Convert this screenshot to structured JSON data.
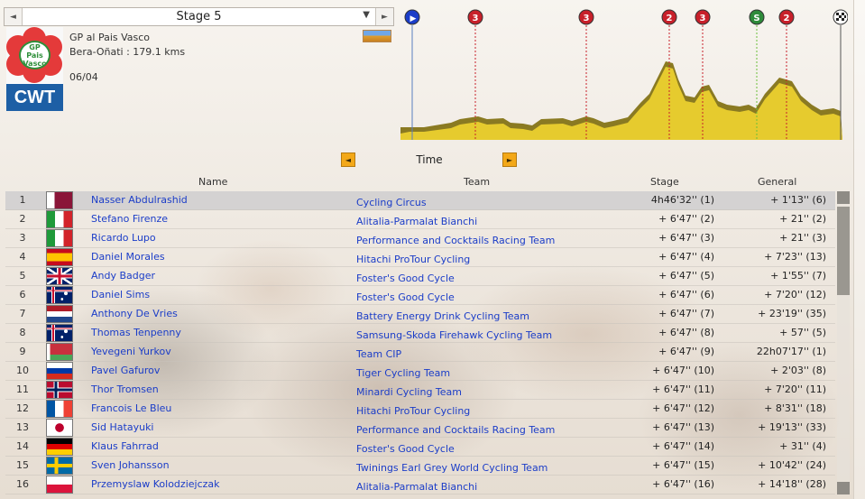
{
  "stage_selector": {
    "label": "Stage 5",
    "prev": "◄",
    "next": "►",
    "dropdown": "▼"
  },
  "race": {
    "logo_text_line1": "GP",
    "logo_text_line2": "Pais Vasco",
    "logo_badge": "CWT",
    "name": "GP al Pais Vasco",
    "route": "Bera-Oñati : 179.1 kms",
    "date": "06/04"
  },
  "profile": {
    "markers": [
      {
        "label": "▶",
        "color": "#1b3dc8",
        "kind": "start"
      },
      {
        "label": "3",
        "color": "#c8202a",
        "kind": "climb"
      },
      {
        "label": "3",
        "color": "#c8202a",
        "kind": "climb"
      },
      {
        "label": "2",
        "color": "#c8202a",
        "kind": "climb"
      },
      {
        "label": "3",
        "color": "#c8202a",
        "kind": "climb"
      },
      {
        "label": "S",
        "color": "#2e8b3a",
        "kind": "sprint"
      },
      {
        "label": "2",
        "color": "#c8202a",
        "kind": "climb"
      },
      {
        "label": "",
        "color": "#222222",
        "kind": "finish"
      }
    ]
  },
  "time_switch": {
    "label": "Time",
    "prev": "◄",
    "next": "►"
  },
  "columns": {
    "name": "Name",
    "team": "Team",
    "stage": "Stage",
    "general": "General"
  },
  "rows": [
    {
      "rank": "1",
      "flag": "qatar",
      "name": "Nasser Abdulrashid",
      "team": "Cycling Circus",
      "stage": "4h46'32'' (1)",
      "general": "+ 1'13'' (6)"
    },
    {
      "rank": "2",
      "flag": "italy",
      "name": "Stefano Firenze",
      "team": "Alitalia-Parmalat Bianchi",
      "stage": "+ 6'47'' (2)",
      "general": "+ 21'' (2)"
    },
    {
      "rank": "3",
      "flag": "italy",
      "name": "Ricardo Lupo",
      "team": "Performance and Cocktails Racing Team",
      "stage": "+ 6'47'' (3)",
      "general": "+ 21'' (3)"
    },
    {
      "rank": "4",
      "flag": "spain",
      "name": "Daniel Morales",
      "team": "Hitachi ProTour Cycling",
      "stage": "+ 6'47'' (4)",
      "general": "+ 7'23'' (13)"
    },
    {
      "rank": "5",
      "flag": "uk",
      "name": "Andy Badger",
      "team": "Foster's Good Cycle",
      "stage": "+ 6'47'' (5)",
      "general": "+ 1'55'' (7)"
    },
    {
      "rank": "6",
      "flag": "australia",
      "name": "Daniel Sims",
      "team": "Foster's Good Cycle",
      "stage": "+ 6'47'' (6)",
      "general": "+ 7'20'' (12)"
    },
    {
      "rank": "7",
      "flag": "netherlands",
      "name": "Anthony De Vries",
      "team": "Battery Energy Drink Cycling Team",
      "stage": "+ 6'47'' (7)",
      "general": "+ 23'19'' (35)"
    },
    {
      "rank": "8",
      "flag": "australia",
      "name": "Thomas Tenpenny",
      "team": "Samsung-Skoda Firehawk Cycling Team",
      "stage": "+ 6'47'' (8)",
      "general": "+ 57'' (5)"
    },
    {
      "rank": "9",
      "flag": "belarus",
      "name": "Yevegeni Yurkov",
      "team": "Team CIP",
      "stage": "+ 6'47'' (9)",
      "general": "22h07'17'' (1)"
    },
    {
      "rank": "10",
      "flag": "russia",
      "name": "Pavel Gafurov",
      "team": "Tiger Cycling Team",
      "stage": "+ 6'47'' (10)",
      "general": "+ 2'03'' (8)"
    },
    {
      "rank": "11",
      "flag": "norway",
      "name": "Thor Tromsen",
      "team": "Minardi Cycling Team",
      "stage": "+ 6'47'' (11)",
      "general": "+ 7'20'' (11)"
    },
    {
      "rank": "12",
      "flag": "france",
      "name": "Francois Le Bleu",
      "team": "Hitachi ProTour Cycling",
      "stage": "+ 6'47'' (12)",
      "general": "+ 8'31'' (18)"
    },
    {
      "rank": "13",
      "flag": "japan",
      "name": "Sid Hatayuki",
      "team": "Performance and Cocktails Racing Team",
      "stage": "+ 6'47'' (13)",
      "general": "+ 19'13'' (33)"
    },
    {
      "rank": "14",
      "flag": "germany",
      "name": "Klaus Fahrrad",
      "team": "Foster's Good Cycle",
      "stage": "+ 6'47'' (14)",
      "general": "+ 31'' (4)"
    },
    {
      "rank": "15",
      "flag": "sweden",
      "name": "Sven Johansson",
      "team": "Twinings Earl Grey World Cycling Team",
      "stage": "+ 6'47'' (15)",
      "general": "+ 10'42'' (24)"
    },
    {
      "rank": "16",
      "flag": "poland",
      "name": "Przemyslaw Kolodziejczak",
      "team": "Alitalia-Parmalat Bianchi",
      "stage": "+ 6'47'' (16)",
      "general": "+ 14'18'' (28)"
    }
  ]
}
